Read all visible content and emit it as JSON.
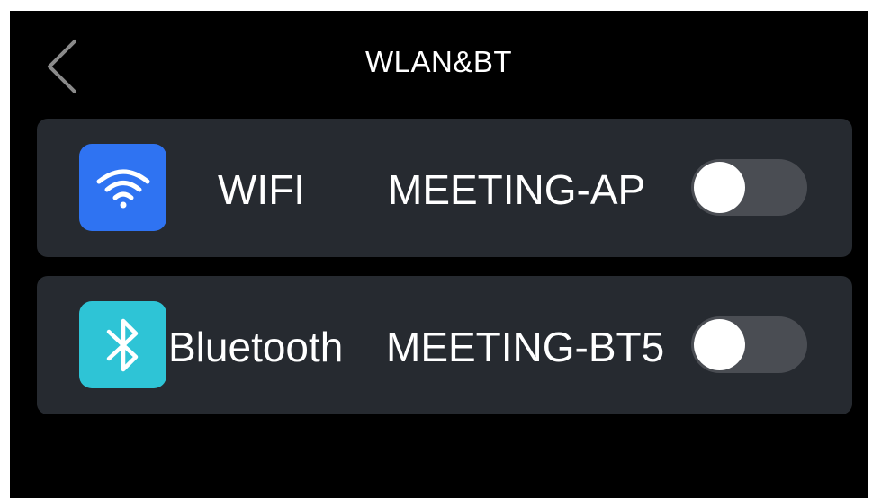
{
  "header": {
    "title": "WLAN&BT",
    "back_icon": "chevron-left-icon"
  },
  "settings": [
    {
      "id": "wifi",
      "icon": "wifi-icon",
      "icon_color": "#2f73f2",
      "label": "WIFI",
      "network": "MEETING-AP",
      "enabled": false
    },
    {
      "id": "bluetooth",
      "icon": "bluetooth-icon",
      "icon_color": "#2ec4d6",
      "label": "Bluetooth",
      "network": "MEETING-BT5",
      "enabled": false
    }
  ],
  "colors": {
    "background": "#000000",
    "card": "#262a30",
    "toggle_off": "#4a4d53",
    "text": "#ffffff"
  }
}
